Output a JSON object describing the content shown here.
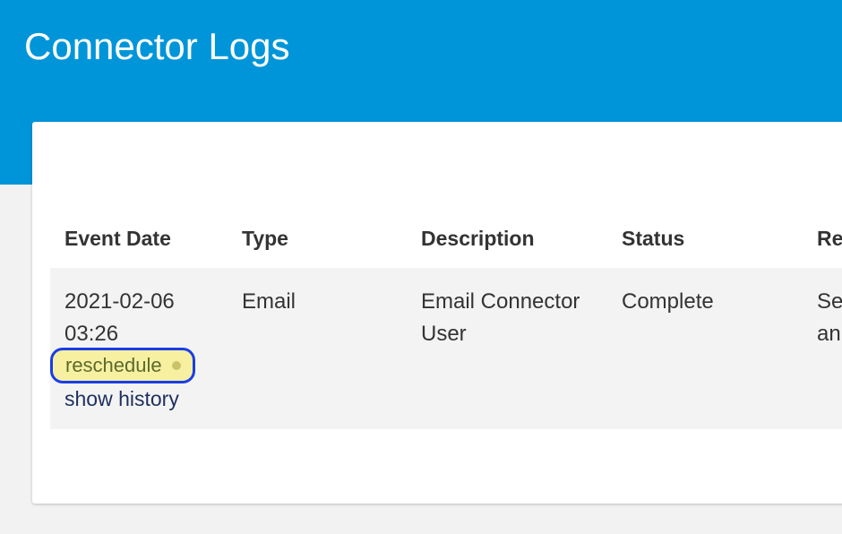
{
  "page": {
    "title": "Connector Logs"
  },
  "table": {
    "columns": [
      "Event Date",
      "Type",
      "Description",
      "Status",
      "Re"
    ],
    "rows": [
      {
        "event_date_line1": "2021-02-06",
        "event_date_line2": "03:26",
        "reschedule_label": "reschedule",
        "history_label": "show history",
        "type": "Email",
        "description_line1": "Email Connector",
        "description_line2": "User",
        "status": "Complete",
        "result_line1": "Se",
        "result_line2": "an"
      }
    ]
  },
  "colors": {
    "header_blue": "#0095d9",
    "reschedule_bg": "#f6f0a0",
    "focus_ring": "#1a3de8"
  }
}
